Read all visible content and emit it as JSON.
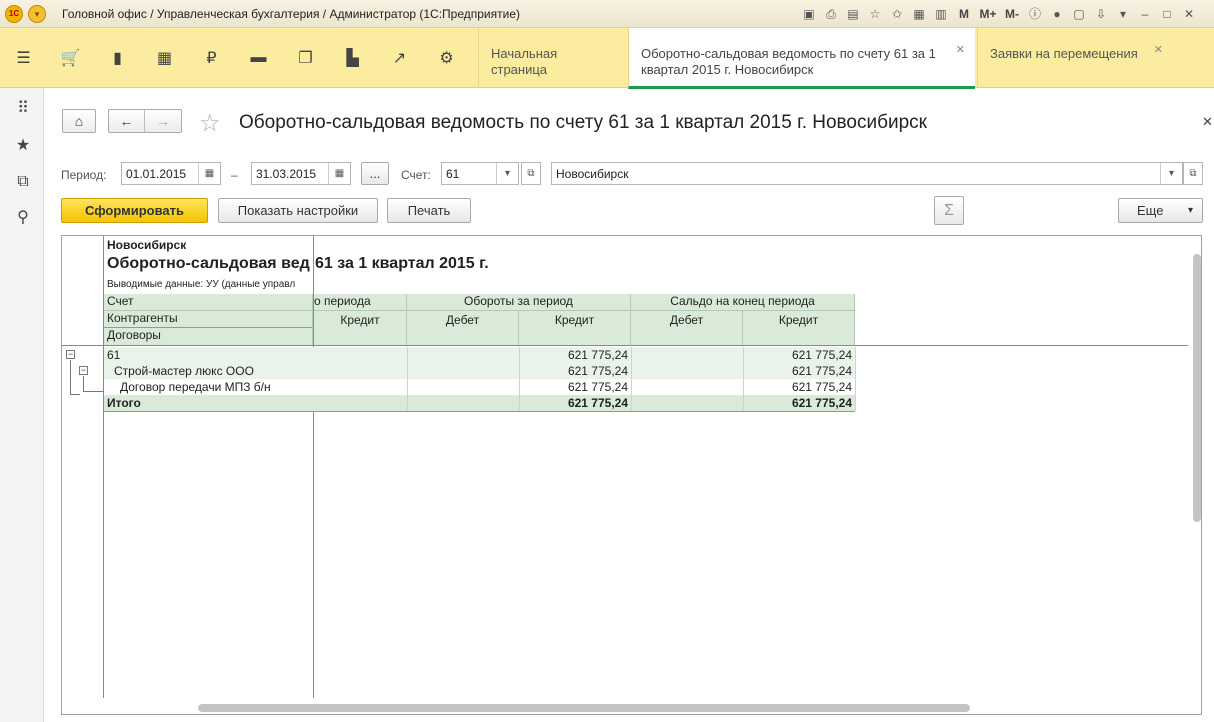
{
  "window": {
    "title": "Головной офис / Управленческая бухгалтерия / Администратор  (1С:Предприятие)",
    "m_labels": [
      "M",
      "M+",
      "M-"
    ]
  },
  "tabs": [
    {
      "label": "Начальная страница"
    },
    {
      "label": "Оборотно-сальдовая ведомость по счету 61 за 1 квартал 2015 г. Новосибирск"
    },
    {
      "label": "Заявки на перемещения"
    }
  ],
  "form": {
    "title": "Оборотно-сальдовая ведомость по счету 61 за 1 квартал 2015 г. Новосибирск",
    "period_label": "Период:",
    "period_from": "01.01.2015",
    "dash": "–",
    "period_to": "31.03.2015",
    "dots": "...",
    "account_label": "Счет:",
    "account_value": "61",
    "org_value": "Новосибирск",
    "generate_button": "Сформировать",
    "settings_button": "Показать настройки",
    "print_button": "Печать",
    "sigma": "Σ",
    "more_button": "Еще"
  },
  "report": {
    "org": "Новосибирск",
    "title_part1": "Оборотно-сальдовая вед",
    "title_part2": "61 за 1 квартал 2015 г.",
    "shown_data": "Выводимые данные: УУ (данные управл",
    "row_headers": [
      "Счет",
      "Контрагенты",
      "Договоры"
    ],
    "col_group_start": "о периода",
    "col_group_turnover": "Обороты за период",
    "col_group_end": "Сальдо на конец периода",
    "col_credit": "Кредит",
    "col_debit": "Дебет",
    "rows": [
      {
        "label": "61",
        "turnover_credit": "621 775,24",
        "end_credit": "621 775,24"
      },
      {
        "label": "Строй-мастер люкс ООО",
        "turnover_credit": "621 775,24",
        "end_credit": "621 775,24"
      },
      {
        "label": "Договор передачи МПЗ б/н",
        "turnover_credit": "621 775,24",
        "end_credit": "621 775,24"
      }
    ],
    "total": {
      "label": "Итого",
      "turnover_credit": "621 775,24",
      "end_credit": "621 775,24"
    }
  }
}
